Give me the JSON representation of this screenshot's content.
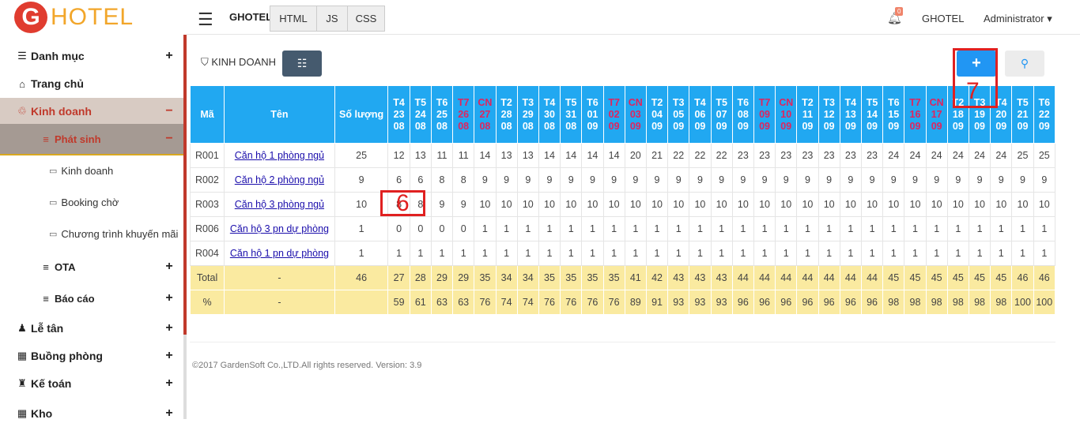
{
  "logo": {
    "letter": "G",
    "text": "HOTEL"
  },
  "topbar": {
    "brand": "GHOTEL",
    "tabs": [
      "HTML",
      "JS",
      "CSS"
    ],
    "notification_count": "0",
    "hotel": "GHOTEL",
    "user": "Administrator ▾"
  },
  "sidebar": {
    "danh_muc": "Danh mục",
    "trang_chu": "Trang chủ",
    "kinh_doanh": "Kinh doanh",
    "phat_sinh": "Phát sinh",
    "leaf_kinh_doanh": "Kinh doanh",
    "leaf_booking": "Booking chờ",
    "leaf_ctkm": "Chương trình khuyến mãi",
    "ota": "OTA",
    "bao_cao": "Báo cáo",
    "le_tan": "Lễ tân",
    "buong_phong": "Buồng phòng",
    "ke_toan": "Kế toán",
    "kho": "Kho",
    "plus": "+",
    "minus": "−"
  },
  "main": {
    "section_title": "KINH DOANH"
  },
  "table": {
    "headers": {
      "ma": "Mã",
      "ten": "Tên",
      "so_luong": "Số lượng"
    },
    "days": [
      {
        "d": "T4",
        "n": "23",
        "m": "08",
        "red": false
      },
      {
        "d": "T5",
        "n": "24",
        "m": "08",
        "red": false
      },
      {
        "d": "T6",
        "n": "25",
        "m": "08",
        "red": false
      },
      {
        "d": "T7",
        "n": "26",
        "m": "08",
        "red": true
      },
      {
        "d": "CN",
        "n": "27",
        "m": "08",
        "red": true
      },
      {
        "d": "T2",
        "n": "28",
        "m": "08",
        "red": false
      },
      {
        "d": "T3",
        "n": "29",
        "m": "08",
        "red": false
      },
      {
        "d": "T4",
        "n": "30",
        "m": "08",
        "red": false
      },
      {
        "d": "T5",
        "n": "31",
        "m": "08",
        "red": false
      },
      {
        "d": "T6",
        "n": "01",
        "m": "09",
        "red": false
      },
      {
        "d": "T7",
        "n": "02",
        "m": "09",
        "red": true
      },
      {
        "d": "CN",
        "n": "03",
        "m": "09",
        "red": true
      },
      {
        "d": "T2",
        "n": "04",
        "m": "09",
        "red": false
      },
      {
        "d": "T3",
        "n": "05",
        "m": "09",
        "red": false
      },
      {
        "d": "T4",
        "n": "06",
        "m": "09",
        "red": false
      },
      {
        "d": "T5",
        "n": "07",
        "m": "09",
        "red": false
      },
      {
        "d": "T6",
        "n": "08",
        "m": "09",
        "red": false
      },
      {
        "d": "T7",
        "n": "09",
        "m": "09",
        "red": true
      },
      {
        "d": "CN",
        "n": "10",
        "m": "09",
        "red": true
      },
      {
        "d": "T2",
        "n": "11",
        "m": "09",
        "red": false
      },
      {
        "d": "T3",
        "n": "12",
        "m": "09",
        "red": false
      },
      {
        "d": "T4",
        "n": "13",
        "m": "09",
        "red": false
      },
      {
        "d": "T5",
        "n": "14",
        "m": "09",
        "red": false
      },
      {
        "d": "T6",
        "n": "15",
        "m": "09",
        "red": false
      },
      {
        "d": "T7",
        "n": "16",
        "m": "09",
        "red": true
      },
      {
        "d": "CN",
        "n": "17",
        "m": "09",
        "red": true
      },
      {
        "d": "T2",
        "n": "18",
        "m": "09",
        "red": false
      },
      {
        "d": "T3",
        "n": "19",
        "m": "09",
        "red": false
      },
      {
        "d": "T4",
        "n": "20",
        "m": "09",
        "red": false
      },
      {
        "d": "T5",
        "n": "21",
        "m": "09",
        "red": false
      },
      {
        "d": "T6",
        "n": "22",
        "m": "09",
        "red": false
      }
    ],
    "rows": [
      {
        "code": "R001",
        "name": "Căn hộ 1 phòng ngủ",
        "qty": "25",
        "vals": [
          "12",
          "13",
          "11",
          "11",
          "14",
          "13",
          "13",
          "14",
          "14",
          "14",
          "14",
          "20",
          "21",
          "22",
          "22",
          "22",
          "23",
          "23",
          "23",
          "23",
          "23",
          "23",
          "23",
          "24",
          "24",
          "24",
          "24",
          "24",
          "24",
          "25",
          "25"
        ]
      },
      {
        "code": "R002",
        "name": "Căn hộ 2 phòng ngủ",
        "qty": "9",
        "vals": [
          "6",
          "6",
          "8",
          "8",
          "9",
          "9",
          "9",
          "9",
          "9",
          "9",
          "9",
          "9",
          "9",
          "9",
          "9",
          "9",
          "9",
          "9",
          "9",
          "9",
          "9",
          "9",
          "9",
          "9",
          "9",
          "9",
          "9",
          "9",
          "9",
          "9",
          "9"
        ]
      },
      {
        "code": "R003",
        "name": "Căn hộ 3 phòng ngủ",
        "qty": "10",
        "vals": [
          "8",
          "8",
          "9",
          "9",
          "10",
          "10",
          "10",
          "10",
          "10",
          "10",
          "10",
          "10",
          "10",
          "10",
          "10",
          "10",
          "10",
          "10",
          "10",
          "10",
          "10",
          "10",
          "10",
          "10",
          "10",
          "10",
          "10",
          "10",
          "10",
          "10",
          "10"
        ]
      },
      {
        "code": "R006",
        "name": "Căn hộ 3 pn dự phòng",
        "qty": "1",
        "vals": [
          "0",
          "0",
          "0",
          "0",
          "1",
          "1",
          "1",
          "1",
          "1",
          "1",
          "1",
          "1",
          "1",
          "1",
          "1",
          "1",
          "1",
          "1",
          "1",
          "1",
          "1",
          "1",
          "1",
          "1",
          "1",
          "1",
          "1",
          "1",
          "1",
          "1",
          "1"
        ]
      },
      {
        "code": "R004",
        "name": "Căn hộ 1 pn dự phòng",
        "qty": "1",
        "vals": [
          "1",
          "1",
          "1",
          "1",
          "1",
          "1",
          "1",
          "1",
          "1",
          "1",
          "1",
          "1",
          "1",
          "1",
          "1",
          "1",
          "1",
          "1",
          "1",
          "1",
          "1",
          "1",
          "1",
          "1",
          "1",
          "1",
          "1",
          "1",
          "1",
          "1",
          "1"
        ]
      }
    ],
    "total": {
      "label": "Total",
      "name": "-",
      "qty": "46",
      "vals": [
        "27",
        "28",
        "29",
        "29",
        "35",
        "34",
        "34",
        "35",
        "35",
        "35",
        "35",
        "41",
        "42",
        "43",
        "43",
        "43",
        "44",
        "44",
        "44",
        "44",
        "44",
        "44",
        "44",
        "45",
        "45",
        "45",
        "45",
        "45",
        "45",
        "46",
        "46"
      ]
    },
    "percent": {
      "label": "%",
      "name": "-",
      "qty": "",
      "vals": [
        "59",
        "61",
        "63",
        "63",
        "76",
        "74",
        "74",
        "76",
        "76",
        "76",
        "76",
        "89",
        "91",
        "93",
        "93",
        "93",
        "96",
        "96",
        "96",
        "96",
        "96",
        "96",
        "96",
        "98",
        "98",
        "98",
        "98",
        "98",
        "98",
        "100",
        "100"
      ]
    }
  },
  "annotations": {
    "marker6": "6",
    "marker7": "7"
  },
  "footer": "©2017 GardenSoft Co.,LTD.All rights reserved. Version: 3.9",
  "colors": {
    "header_blue": "#21a8f1",
    "weekend_red": "#e0245e",
    "total_yellow": "#faeaa0",
    "accent_red": "#c0392b"
  }
}
